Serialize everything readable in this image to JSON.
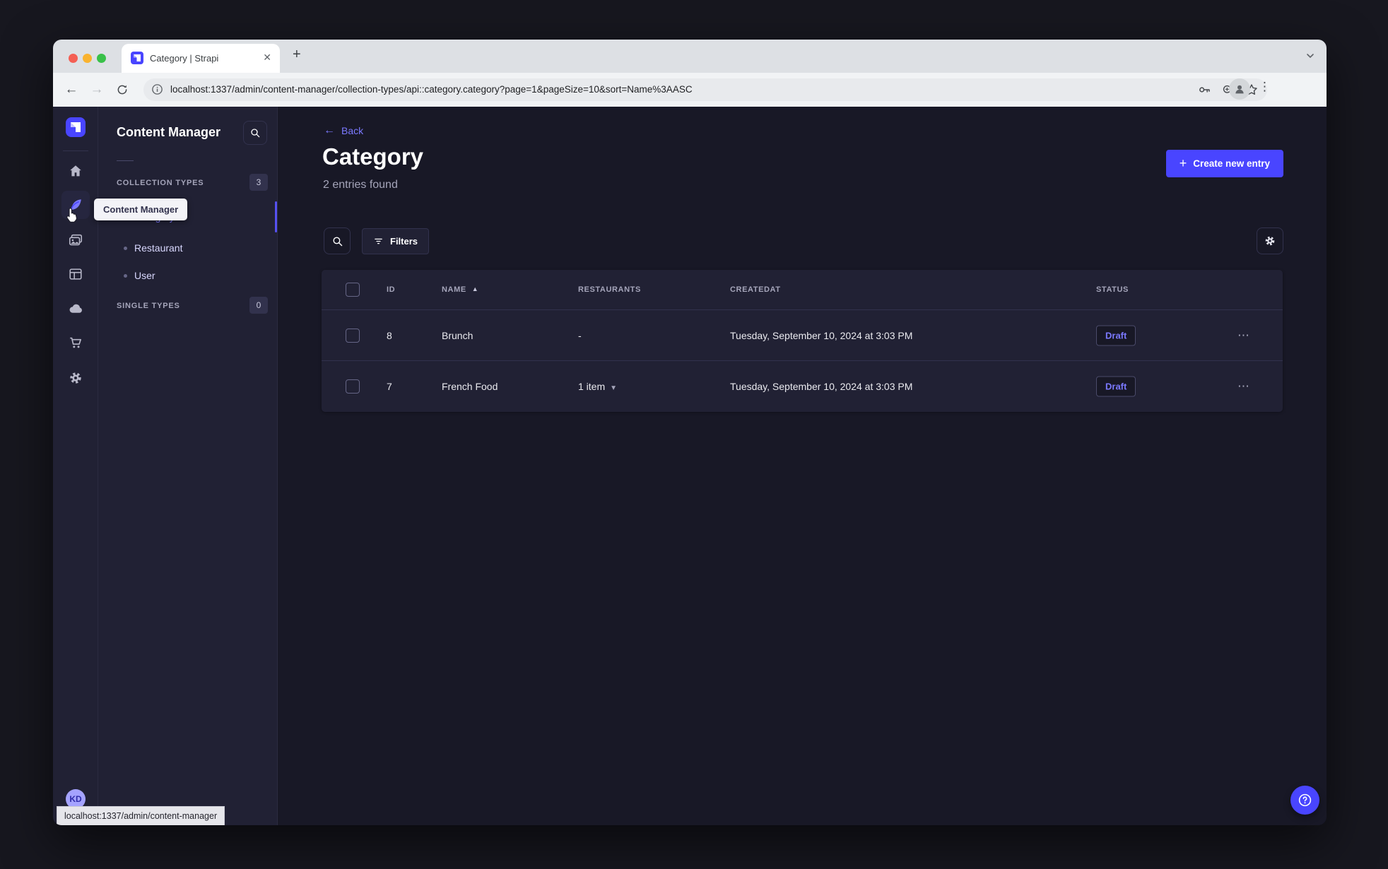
{
  "colors": {
    "accent": "#4945ff",
    "accent_light": "#7b79ff",
    "surface": "#212134",
    "background": "#181826",
    "border": "#32324d"
  },
  "browser": {
    "tab_title": "Category | Strapi",
    "new_tab_label": "+",
    "close_tab_label": "✕",
    "url": "localhost:1337/admin/content-manager/collection-types/api::category.category?page=1&pageSize=10&sort=Name%3AASC",
    "back_glyph": "←",
    "forward_glyph": "→",
    "kebab_glyph": "⋮"
  },
  "subnav": {
    "title": "Content Manager",
    "collection_types_label": "COLLECTION TYPES",
    "collection_types_count": "3",
    "items": [
      {
        "label": "Category"
      },
      {
        "label": "Restaurant"
      },
      {
        "label": "User"
      }
    ],
    "single_types_label": "SINGLE TYPES",
    "single_types_count": "0"
  },
  "tooltip": {
    "text": "Content Manager"
  },
  "status_bar": {
    "text": "localhost:1337/admin/content-manager"
  },
  "user": {
    "initials": "KD"
  },
  "main": {
    "back_label": "Back",
    "back_glyph": "←",
    "title": "Category",
    "subtitle": "2 entries found",
    "create_button_label": "Create new entry",
    "create_plus_glyph": "+",
    "filters_button_label": "Filters"
  },
  "table": {
    "headers": {
      "id": "ID",
      "name": "NAME",
      "restaurants": "RESTAURANTS",
      "createdat": "CREATEDAT",
      "status": "STATUS"
    },
    "sort_caret_glyph": "▲",
    "kebab_glyph": "⋯",
    "relation_chevron_glyph": "▼",
    "rows": [
      {
        "id": "8",
        "name": "Brunch",
        "restaurants": "-",
        "createdat": "Tuesday, September 10, 2024 at 3:03 PM",
        "status": "Draft"
      },
      {
        "id": "7",
        "name": "French Food",
        "restaurants": "1 item",
        "createdat": "Tuesday, September 10, 2024 at 3:03 PM",
        "status": "Draft"
      }
    ]
  }
}
